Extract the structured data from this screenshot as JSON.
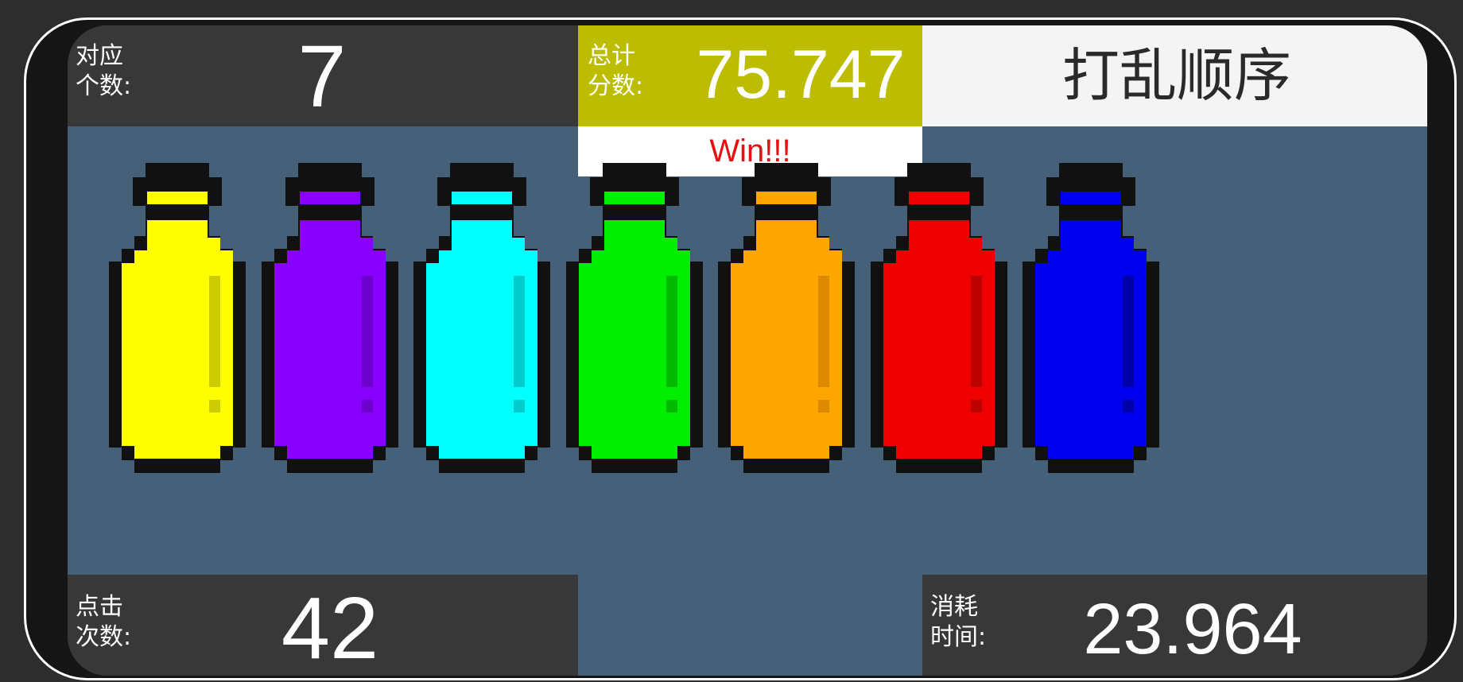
{
  "match_panel": {
    "label": "对应\n个数:",
    "value": "7"
  },
  "score_panel": {
    "label": "总计\n分数:",
    "value": "75.747",
    "bg_color": "#bcbc00"
  },
  "win_text": "Win!!!",
  "shuffle_button_label": "打乱顺序",
  "clicks_panel": {
    "label": "点击\n次数:",
    "value": "42"
  },
  "time_panel": {
    "label": "消耗\n时间:",
    "value": "23.964"
  },
  "bottles": [
    {
      "name": "yellow",
      "color": "#ffff00",
      "highlight": "#cccc00"
    },
    {
      "name": "purple",
      "color": "#8800ff",
      "highlight": "#6e00cc"
    },
    {
      "name": "cyan",
      "color": "#00ffff",
      "highlight": "#00cccc"
    },
    {
      "name": "green",
      "color": "#00ee00",
      "highlight": "#00bb00"
    },
    {
      "name": "orange",
      "color": "#ffa500",
      "highlight": "#dd8a00"
    },
    {
      "name": "red",
      "color": "#ee0000",
      "highlight": "#bb0000"
    },
    {
      "name": "blue",
      "color": "#0000ee",
      "highlight": "#0000aa"
    }
  ],
  "colors": {
    "background": "#2d2d2d",
    "board": "#456078",
    "panel": "#383838",
    "win_text": "#e31111",
    "outline": "#111111"
  }
}
